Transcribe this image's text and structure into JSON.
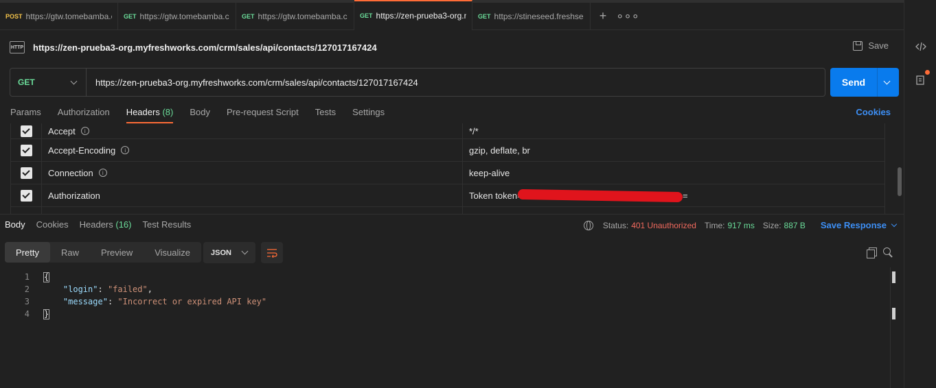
{
  "tabs": [
    {
      "method": "POST",
      "url": "https://gtw.tomebamba.c"
    },
    {
      "method": "GET",
      "url": "https://gtw.tomebamba.c"
    },
    {
      "method": "GET",
      "url": "https://gtw.tomebamba.c"
    },
    {
      "method": "GET",
      "url": "https://zen-prueba3-org.m"
    },
    {
      "method": "GET",
      "url": "https://stineseed.freshse"
    }
  ],
  "tabbar": {
    "plus": "+",
    "more": "∘∘∘"
  },
  "request": {
    "icon_text": "HTTP",
    "title": "https://zen-prueba3-org.myfreshworks.com/crm/sales/api/contacts/127017167424",
    "save_label": "Save",
    "method": "GET",
    "url": "https://zen-prueba3-org.myfreshworks.com/crm/sales/api/contacts/127017167424",
    "send_label": "Send"
  },
  "request_tabs": {
    "params": "Params",
    "authorization": "Authorization",
    "headers": "Headers",
    "headers_count": "(8)",
    "body": "Body",
    "prerequest": "Pre-request Script",
    "tests": "Tests",
    "settings": "Settings",
    "cookies": "Cookies"
  },
  "headers": [
    {
      "key": "Accept",
      "value": "*/*"
    },
    {
      "key": "Accept-Encoding",
      "value": "gzip, deflate, br"
    },
    {
      "key": "Connection",
      "value": "keep-alive"
    },
    {
      "key": "Authorization",
      "value": "Token token=",
      "value_tail": "="
    }
  ],
  "response": {
    "tabs": {
      "body": "Body",
      "cookies": "Cookies",
      "headers": "Headers",
      "headers_count": "(16)",
      "test_results": "Test Results"
    },
    "status_label": "Status:",
    "status": "401 Unauthorized",
    "time_label": "Time:",
    "time": "917 ms",
    "size_label": "Size:",
    "size": "887 B",
    "save_response": "Save Response",
    "views": {
      "pretty": "Pretty",
      "raw": "Raw",
      "preview": "Preview",
      "visualize": "Visualize"
    },
    "format": "JSON",
    "lines": {
      "n1": "1",
      "n2": "2",
      "n3": "3",
      "n4": "4",
      "open": "{",
      "k1": "\"login\"",
      "v1": "\"failed\"",
      "k2": "\"message\"",
      "v2": "\"Incorrect or expired API key\"",
      "close": "}"
    }
  },
  "colors": {
    "accent": "#ff6c37",
    "send": "#097bed",
    "get": "#6bdd9a",
    "post": "#f5c44a",
    "error": "#f26a5e",
    "link": "#3d8ff5"
  }
}
